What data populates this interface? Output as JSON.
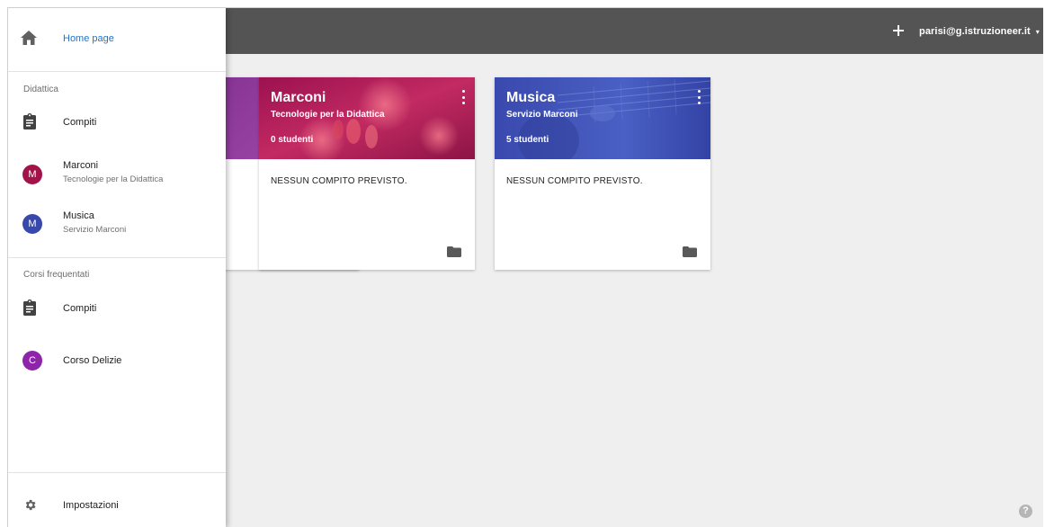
{
  "topbar": {
    "add_icon": "plus-icon",
    "account_email": "parisi@g.istruzioneer.it",
    "account_caret": "▾"
  },
  "drawer": {
    "home_label": "Home page",
    "section_teaching": "Didattica",
    "teaching_items": [
      {
        "label": "Compiti",
        "icon": "assignment-icon"
      },
      {
        "label": "Marconi",
        "sublabel": "Tecnologie per la Didattica",
        "avatar": "M",
        "color": "#a4124a"
      },
      {
        "label": "Musica",
        "sublabel": "Servizio Marconi",
        "avatar": "M",
        "color": "#3949ab"
      }
    ],
    "section_enrolled": "Corsi frequentati",
    "enrolled_items": [
      {
        "label": "Compiti",
        "icon": "assignment-icon"
      },
      {
        "label": "Corso Delizie",
        "avatar": "C",
        "color": "#8e24aa"
      }
    ],
    "settings_label": "Impostazioni"
  },
  "cards": [
    {
      "title": "Marconi",
      "subtitle": "Tecnologie per la Didattica",
      "count": "0 studenti",
      "message": "NESSUN COMPITO PREVISTO.",
      "color": "#b0185a"
    },
    {
      "title": "Musica",
      "subtitle": "Servizio Marconi",
      "count": "5 studenti",
      "message": "NESSUN COMPITO PREVISTO.",
      "color": "#3e4fb2"
    }
  ],
  "help_label": "?"
}
